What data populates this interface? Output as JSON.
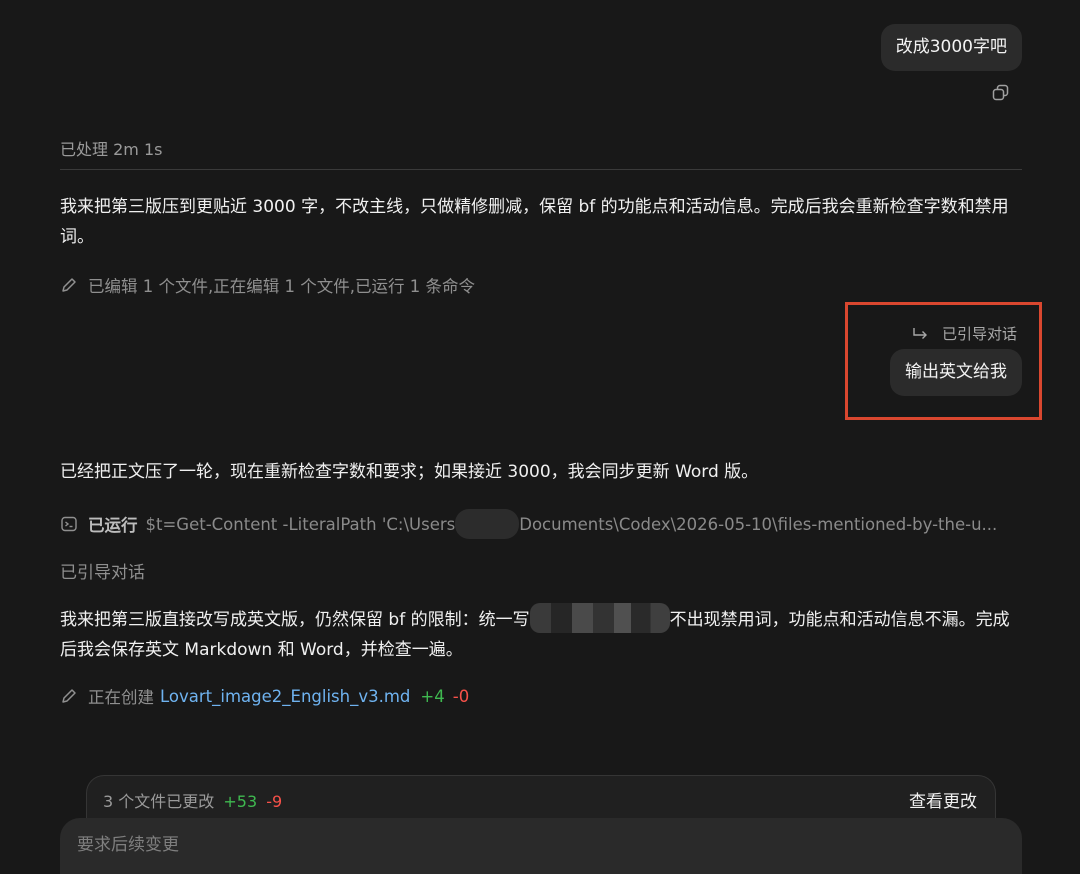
{
  "user_message": {
    "text": "改成3000字吧"
  },
  "processed": {
    "text": "已处理 2m 1s"
  },
  "assistant_1": {
    "text": "我来把第三版压到更贴近 3000 字，不改主线，只做精修删减，保留 bf 的功能点和活动信息。完成后我会重新检查字数和禁用词。"
  },
  "activity_1": {
    "text": "已编辑 1 个文件,正在编辑 1 个文件,已运行 1 条命令",
    "icon": "pencil-icon"
  },
  "steer": {
    "label": "已引导对话",
    "message": "输出英文给我",
    "icon": "return-arrow-icon",
    "highlight_color": "#d9472f"
  },
  "assistant_2": {
    "text": "已经把正文压了一轮，现在重新检查字数和要求；如果接近 3000，我会同步更新 Word 版。"
  },
  "command": {
    "label": "已运行",
    "cmd_before": "$t=Get-Content -LiteralPath 'C:\\Users",
    "cmd_after": "Documents\\Codex\\2026-05-10\\files-mentioned-by-the-u...",
    "icon": "terminal-icon"
  },
  "steer_plain": {
    "text": "已引导对话"
  },
  "assistant_3": {
    "before": "我来把第三版直接改写成英文版，仍然保留 bf 的限制：统一写",
    "after": "不出现禁用词，功能点和活动信息不漏。完成后我会保存英文 Markdown 和 Word，并检查一遍。"
  },
  "creating": {
    "label": "正在创建",
    "file": "Lovart_image2_English_v3.md",
    "added": "+4",
    "removed": "-0",
    "icon": "pencil-icon"
  },
  "changes": {
    "summary": "3 个文件已更改",
    "added": "+53",
    "removed": "-9",
    "view_label": "查看更改"
  },
  "composer": {
    "placeholder": "要求后续变更"
  },
  "colors": {
    "background": "#181818",
    "bubble": "#2b2b2b",
    "added": "#3fb950",
    "removed": "#f85149",
    "link": "#6fb3f0"
  }
}
